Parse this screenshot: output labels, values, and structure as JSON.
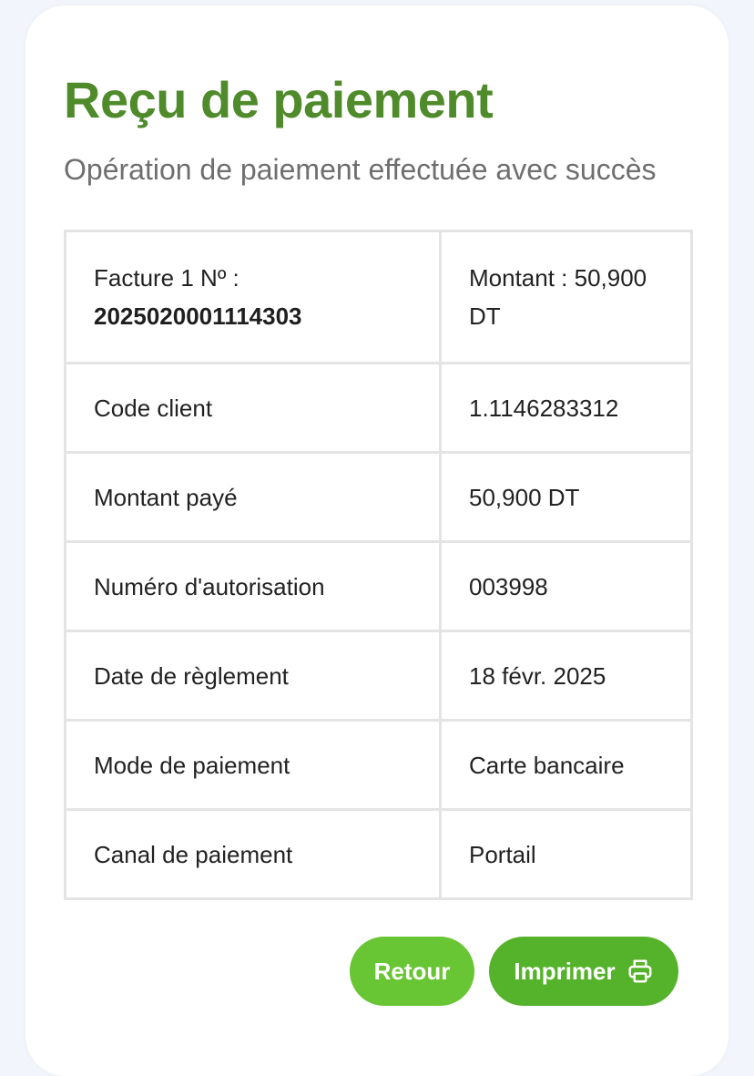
{
  "header": {
    "title": "Reçu de paiement",
    "subtitle": "Opération de paiement effectuée avec succès"
  },
  "invoice": {
    "label": "Facture 1 Nº :",
    "number": "2025020001114303",
    "amount": "Montant : 50,900 DT"
  },
  "details": [
    {
      "label": "Code client",
      "value": "1.1146283312"
    },
    {
      "label": "Montant payé",
      "value": "50,900 DT"
    },
    {
      "label": "Numéro d'autorisation",
      "value": "003998"
    },
    {
      "label": "Date de règlement",
      "value": "18 févr. 2025"
    },
    {
      "label": "Mode de paiement",
      "value": "Carte bancaire"
    },
    {
      "label": "Canal de paiement",
      "value": "Portail"
    }
  ],
  "actions": {
    "back_label": "Retour",
    "print_label": "Imprimer",
    "print_icon": "printer-icon"
  },
  "colors": {
    "title": "#4f8a2b",
    "back_button": "#68c533",
    "print_button": "#55b22b",
    "background": "#f2f5fb"
  }
}
